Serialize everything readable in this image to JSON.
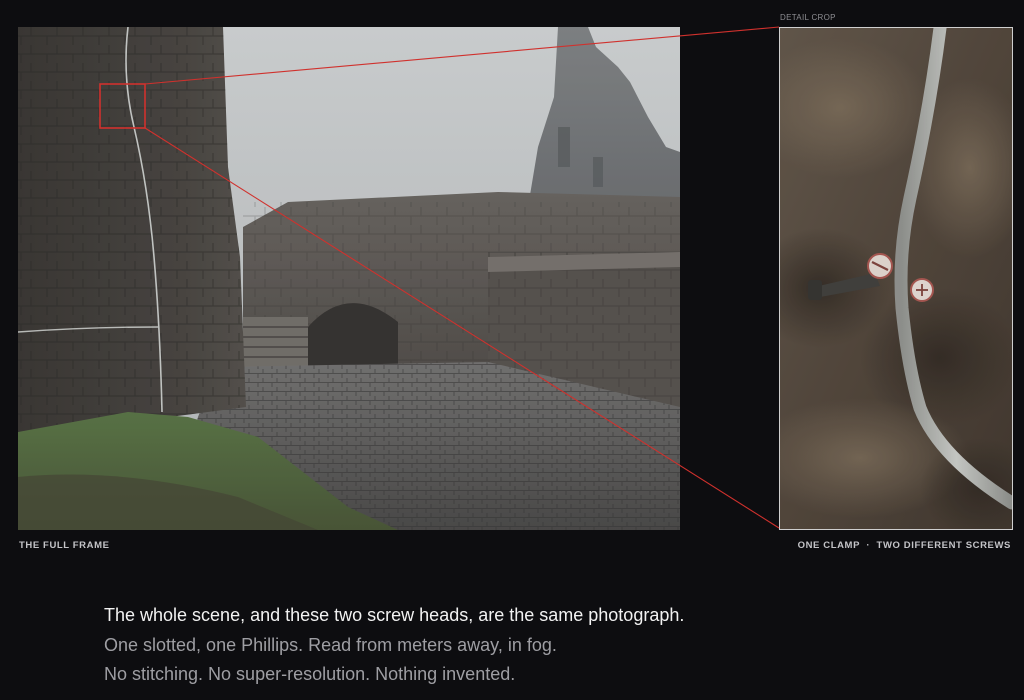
{
  "labels": {
    "detail_crop": "DETAIL CROP",
    "full_frame": "THE FULL FRAME",
    "crop_caption": "ONE CLAMP  ·  TWO DIFFERENT SCREWS"
  },
  "body_text": {
    "line1": "The whole scene, and these two screw heads, are the same photograph.",
    "line2": "One slotted, one Phillips. Read from meters away, in fog.",
    "line3": "No stitching. No super-resolution. Nothing invented."
  },
  "colors": {
    "background": "#0d0d10",
    "callout_red": "#d0312d",
    "crop_border": "#cfcfcf",
    "primary_text": "#f2f2f2",
    "secondary_text": "#9e9ea3"
  }
}
